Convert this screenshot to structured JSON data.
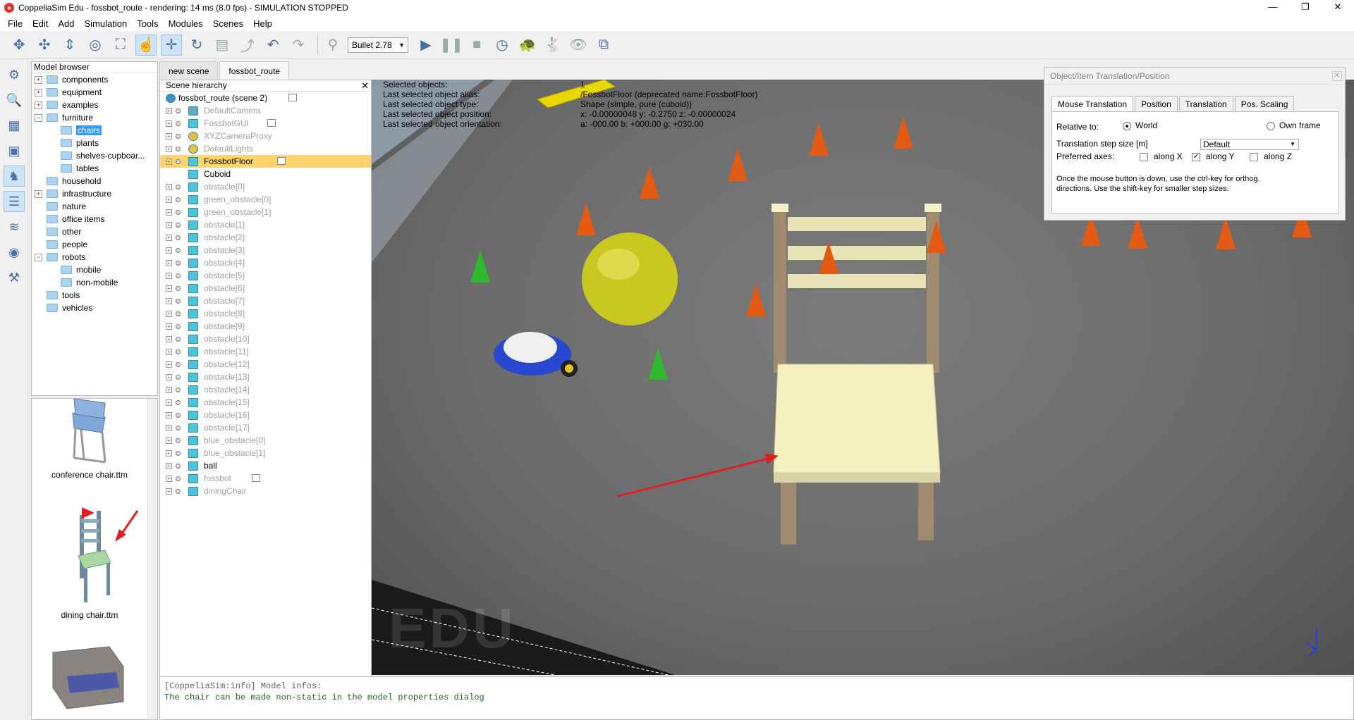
{
  "window": {
    "title": "CoppeliaSim Edu - fossbot_route - rendering: 14 ms (8.0 fps) - SIMULATION STOPPED",
    "min": "—",
    "max": "❐",
    "close": "✕"
  },
  "menu": [
    "File",
    "Edit",
    "Add",
    "Simulation",
    "Tools",
    "Modules",
    "Scenes",
    "Help"
  ],
  "toolbar": {
    "engine": "Bullet 2.78"
  },
  "model_browser": {
    "header": "Model browser",
    "items": [
      {
        "label": "components",
        "exp": "+",
        "indent": 0
      },
      {
        "label": "equipment",
        "exp": "+",
        "indent": 0
      },
      {
        "label": "examples",
        "exp": "+",
        "indent": 0
      },
      {
        "label": "furniture",
        "exp": "−",
        "indent": 0
      },
      {
        "label": "chairs",
        "exp": "",
        "indent": 1,
        "selected": true
      },
      {
        "label": "plants",
        "exp": "",
        "indent": 1
      },
      {
        "label": "shelves-cupboar...",
        "exp": "",
        "indent": 1
      },
      {
        "label": "tables",
        "exp": "",
        "indent": 1
      },
      {
        "label": "household",
        "exp": "",
        "indent": 0
      },
      {
        "label": "infrastructure",
        "exp": "+",
        "indent": 0
      },
      {
        "label": "nature",
        "exp": "",
        "indent": 0
      },
      {
        "label": "office items",
        "exp": "",
        "indent": 0
      },
      {
        "label": "other",
        "exp": "",
        "indent": 0
      },
      {
        "label": "people",
        "exp": "",
        "indent": 0
      },
      {
        "label": "robots",
        "exp": "−",
        "indent": 0
      },
      {
        "label": "mobile",
        "exp": "",
        "indent": 1
      },
      {
        "label": "non-mobile",
        "exp": "",
        "indent": 1
      },
      {
        "label": "tools",
        "exp": "",
        "indent": 0
      },
      {
        "label": "vehicles",
        "exp": "",
        "indent": 0
      }
    ]
  },
  "thumbnails": [
    {
      "label": "conference chair.ttm"
    },
    {
      "label": "dining chair.ttm"
    }
  ],
  "tabs": [
    "new scene",
    "fossbot_route"
  ],
  "hierarchy": {
    "header": "Scene hierarchy",
    "root": "fossbot_route (scene 2)",
    "rows": [
      {
        "label": "DefaultCamera",
        "dim": true,
        "icon": "cam"
      },
      {
        "label": "FossbotGUI",
        "dim": true,
        "icon": "shape",
        "doc": true
      },
      {
        "label": "XYZCameraProxy",
        "dim": true,
        "icon": "light"
      },
      {
        "label": "DefaultLights",
        "dim": true,
        "icon": "light"
      },
      {
        "label": "FossbotFloor",
        "dim": false,
        "icon": "shape",
        "selected": true,
        "doc": true
      },
      {
        "label": "Cuboid",
        "dim": false,
        "icon": "shape",
        "child": true
      },
      {
        "label": "obstacle[0]",
        "dim": true,
        "icon": "shape"
      },
      {
        "label": "green_obstacle[0]",
        "dim": true,
        "icon": "shape"
      },
      {
        "label": "green_obstacle[1]",
        "dim": true,
        "icon": "shape"
      },
      {
        "label": "obstacle[1]",
        "dim": true,
        "icon": "shape"
      },
      {
        "label": "obstacle[2]",
        "dim": true,
        "icon": "shape"
      },
      {
        "label": "obstacle[3]",
        "dim": true,
        "icon": "shape"
      },
      {
        "label": "obstacle[4]",
        "dim": true,
        "icon": "shape"
      },
      {
        "label": "obstacle[5]",
        "dim": true,
        "icon": "shape"
      },
      {
        "label": "obstacle[6]",
        "dim": true,
        "icon": "shape"
      },
      {
        "label": "obstacle[7]",
        "dim": true,
        "icon": "shape"
      },
      {
        "label": "obstacle[8]",
        "dim": true,
        "icon": "shape"
      },
      {
        "label": "obstacle[9]",
        "dim": true,
        "icon": "shape"
      },
      {
        "label": "obstacle[10]",
        "dim": true,
        "icon": "shape"
      },
      {
        "label": "obstacle[11]",
        "dim": true,
        "icon": "shape"
      },
      {
        "label": "obstacle[12]",
        "dim": true,
        "icon": "shape"
      },
      {
        "label": "obstacle[13]",
        "dim": true,
        "icon": "shape"
      },
      {
        "label": "obstacle[14]",
        "dim": true,
        "icon": "shape"
      },
      {
        "label": "obstacle[15]",
        "dim": true,
        "icon": "shape"
      },
      {
        "label": "obstacle[16]",
        "dim": true,
        "icon": "shape"
      },
      {
        "label": "obstacle[17]",
        "dim": true,
        "icon": "shape"
      },
      {
        "label": "blue_obstacle[0]",
        "dim": true,
        "icon": "shape"
      },
      {
        "label": "blue_obstacle[1]",
        "dim": true,
        "icon": "shape"
      },
      {
        "label": "ball",
        "dim": false,
        "icon": "shape"
      },
      {
        "label": "fossbot",
        "dim": true,
        "icon": "shape",
        "doc": true
      },
      {
        "label": "diningChair",
        "dim": true,
        "icon": "shape"
      }
    ]
  },
  "viewport_info": [
    {
      "k": "Selected objects:",
      "v": "1"
    },
    {
      "k": "Last selected object alias:",
      "v": "/FossbotFloor   (deprecated name:FossbotFloor)"
    },
    {
      "k": "Last selected object type:",
      "v": "Shape (simple, pure (cuboid))"
    },
    {
      "k": "Last selected object position:",
      "v": "x: -0.00000048   y: -0.2750   z: -0.00000024"
    },
    {
      "k": "Last selected object orientation:",
      "v": "a: -000.00   b: +000.00   g: +030.00"
    }
  ],
  "watermark": "EDU",
  "panel": {
    "title": "Object/Item Translation/Position",
    "tabs": [
      "Mouse Translation",
      "Position",
      "Translation",
      "Pos. Scaling"
    ],
    "relative_to": "Relative to:",
    "world": "World",
    "own_frame": "Own frame",
    "step_label": "Translation step size [m]",
    "step_value": "Default",
    "axes_label": "Preferred axes:",
    "ax": "along X",
    "ay": "along Y",
    "az": "along Z",
    "hint1": "Once the mouse button is down, use the ctrl-key for orthog.",
    "hint2": "directions. Use the shift-key for smaller step sizes."
  },
  "console": {
    "line1": "[CoppeliaSim:info] Model infos:",
    "line2": "The chair can be made non-static in the model properties dialog"
  },
  "colors": {
    "selection": "#3399ff",
    "hier_selected": "#ffd36e",
    "arrow": "#e02020"
  }
}
